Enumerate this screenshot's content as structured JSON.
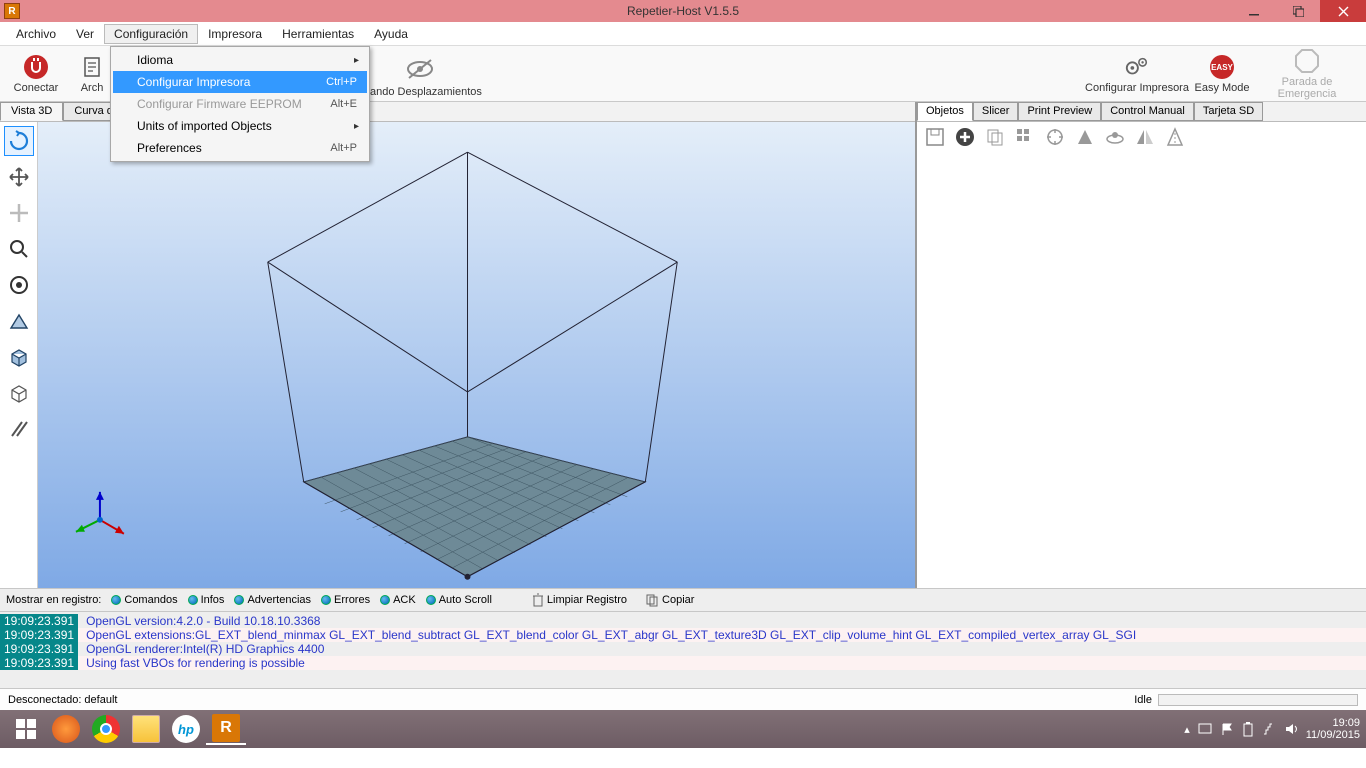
{
  "window": {
    "title": "Repetier-Host V1.5.5",
    "app_icon_letter": "R"
  },
  "menu": {
    "items": [
      "Archivo",
      "Ver",
      "Configuración",
      "Impresora",
      "Herramientas",
      "Ayuda"
    ],
    "open_index": 2
  },
  "dropdown": {
    "items": [
      {
        "label": "Idioma",
        "shortcut": "",
        "submenu": true
      },
      {
        "label": "Configurar Impresora",
        "shortcut": "Ctrl+P",
        "highlight": true
      },
      {
        "label": "Configurar Firmware EEPROM",
        "shortcut": "Alt+E",
        "disabled": true
      },
      {
        "label": "Units of imported Objects",
        "shortcut": "",
        "submenu": true
      },
      {
        "label": "Preferences",
        "shortcut": "Alt+P"
      }
    ]
  },
  "toolbar": {
    "connect": "Conectar",
    "archive": "Arch",
    "offset_tail": "ando Desplazamientos",
    "conf_printer": "Configurar Impresora",
    "easy_mode": "Easy Mode",
    "emergency": "Parada de Emergencia"
  },
  "view_tabs": {
    "tab1": "Vista 3D",
    "tab2": "Curva de"
  },
  "right_tabs": [
    "Objetos",
    "Slicer",
    "Print Preview",
    "Control Manual",
    "Tarjeta SD"
  ],
  "log_options": {
    "label": "Mostrar en registro:",
    "items": [
      "Comandos",
      "Infos",
      "Advertencias",
      "Errores",
      "ACK",
      "Auto Scroll"
    ],
    "clear": "Limpiar Registro",
    "copy": "Copiar"
  },
  "log": [
    {
      "ts": "19:09:23.391",
      "msg": "OpenGL version:4.2.0 - Build 10.18.10.3368"
    },
    {
      "ts": "19:09:23.391",
      "msg": "OpenGL extensions:GL_EXT_blend_minmax GL_EXT_blend_subtract GL_EXT_blend_color GL_EXT_abgr GL_EXT_texture3D GL_EXT_clip_volume_hint GL_EXT_compiled_vertex_array GL_SGI"
    },
    {
      "ts": "19:09:23.391",
      "msg": "OpenGL renderer:Intel(R) HD Graphics 4400"
    },
    {
      "ts": "19:09:23.391",
      "msg": "Using fast VBOs for rendering is possible"
    }
  ],
  "status": {
    "left": "Desconectado: default",
    "right": "Idle"
  },
  "taskbar": {
    "time": "19:09",
    "date": "11/09/2015"
  }
}
